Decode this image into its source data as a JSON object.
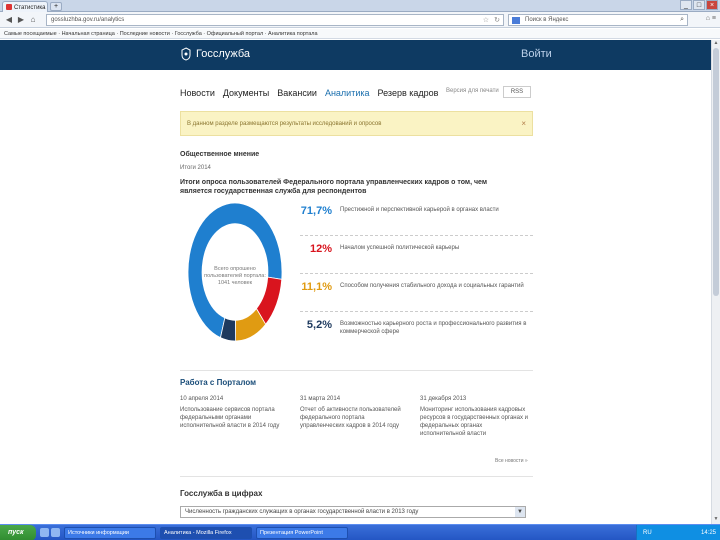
{
  "browser": {
    "tab_title": "Статистика",
    "url": "gossluzhba.gov.ru/analytics",
    "search_placeholder": "Поиск в Яндекс",
    "bookmarks": "Самые посещаемые · Начальная страница · Последние новости · Госслужба · Официальный портал · Аналитика портала",
    "window_buttons": [
      "_",
      "□",
      "×"
    ]
  },
  "site": {
    "logo_text": "Госслужба",
    "header_right": "Войти",
    "nav": [
      {
        "label": "Новости",
        "active": false
      },
      {
        "label": "Документы",
        "active": false
      },
      {
        "label": "Вакансии",
        "active": false
      },
      {
        "label": "Аналитика",
        "active": true
      },
      {
        "label": "Резерв кадров",
        "active": false
      }
    ],
    "nav_right_text": "Версия для печати",
    "nav_button": "RSS",
    "notice": "В данном разделе размещаются результаты исследований и опросов",
    "notice_close": "×"
  },
  "opinion": {
    "section_title": "Общественное мнение",
    "date": "Итоги 2014",
    "question": "Итоги опроса пользователей Федерального портала управленческих кадров о том, чем является государственная служба для респондентов",
    "center_text": "Всего опрошено пользователей портала: 1041 человек",
    "results": [
      {
        "pct": "71,7%",
        "value": 71.7,
        "color": "#1f7fcf",
        "text": "Престижной и перспективной карьерой в органах власти"
      },
      {
        "pct": "12%",
        "value": 12,
        "color": "#d9141e",
        "text": "Началом успешной политической карьеры"
      },
      {
        "pct": "11,1%",
        "value": 11.1,
        "color": "#e09b12",
        "text": "Способом получения стабильного дохода и социальных гарантий"
      },
      {
        "pct": "5,2%",
        "value": 5.2,
        "color": "#1e3a5f",
        "text": "Возможностью карьерного роста и профессионального развития в коммерческой сфере"
      }
    ]
  },
  "portal": {
    "title": "Работа с Порталом",
    "news": [
      {
        "date": "10 апреля 2014",
        "text": "Использование сервисов портала федеральными органами исполнительной власти в 2014 году"
      },
      {
        "date": "31 марта 2014",
        "text": "Отчет об активности пользователей федерального портала управленческих кадров в 2014 году"
      },
      {
        "date": "31 декабря 2013",
        "text": "Мониторинг использования кадровых ресурсов в государственных органах и федеральных органах исполнительной власти"
      }
    ],
    "all_news": "Все новости »"
  },
  "gs": {
    "title": "Госслужба в цифрах",
    "select_value": "Численность гражданских служащих в органах государственной власти в 2013 году",
    "select_arrow": "▼"
  },
  "taskbar": {
    "start": "пуск",
    "buttons": [
      {
        "label": "Источники информации",
        "active": false
      },
      {
        "label": "Аналитика - Mozilla Firefox",
        "active": true
      },
      {
        "label": "Презентация PowerPoint",
        "active": false
      }
    ],
    "tray_lang": "RU",
    "clock": "14:25"
  }
}
